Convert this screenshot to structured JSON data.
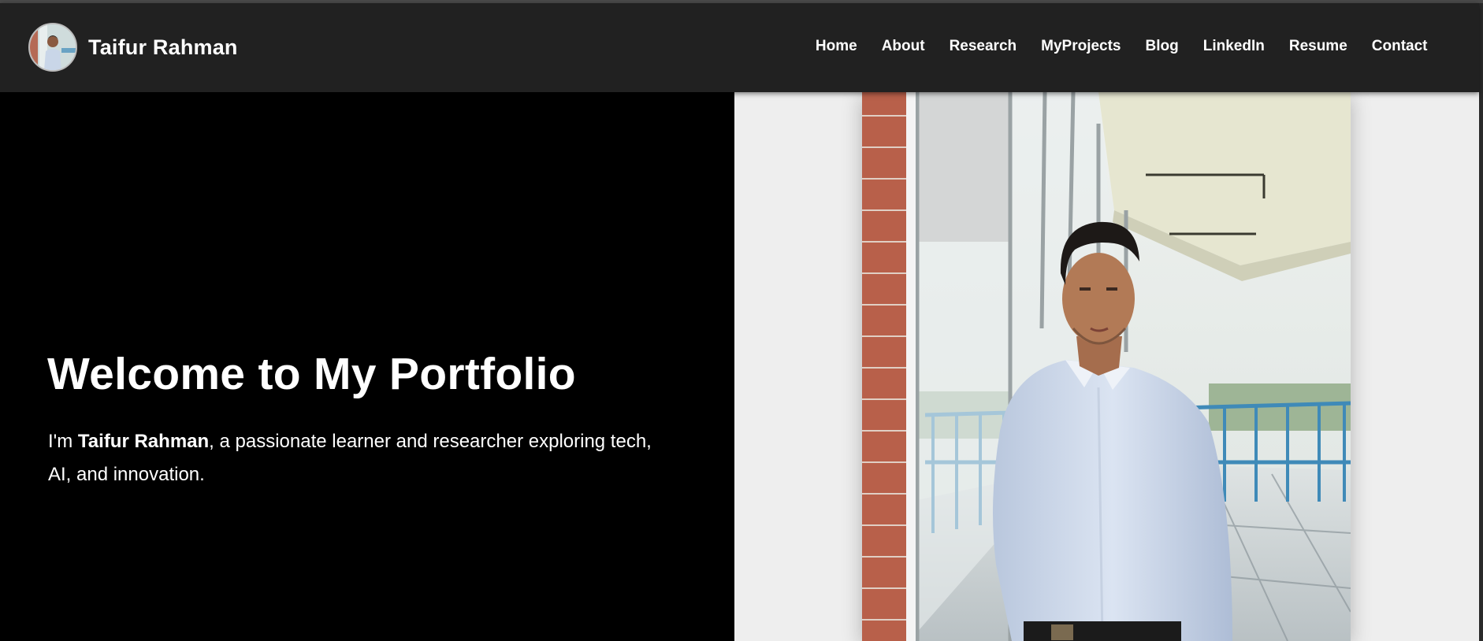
{
  "brand": {
    "name": "Taifur Rahman"
  },
  "nav": {
    "items": [
      {
        "label": "Home"
      },
      {
        "label": "About"
      },
      {
        "label": "Research"
      },
      {
        "label": "MyProjects"
      },
      {
        "label": "Blog"
      },
      {
        "label": "LinkedIn"
      },
      {
        "label": "Resume"
      },
      {
        "label": "Contact"
      }
    ]
  },
  "hero": {
    "title": "Welcome to My Portfolio",
    "intro_prefix": "I'm ",
    "intro_name": "Taifur Rahman",
    "intro_suffix": ", a passionate learner and researcher exploring tech, AI, and innovation."
  },
  "colors": {
    "navbar_bg": "#212121",
    "hero_left_bg": "#000000",
    "hero_right_bg": "#eeeeee",
    "text": "#ffffff"
  }
}
